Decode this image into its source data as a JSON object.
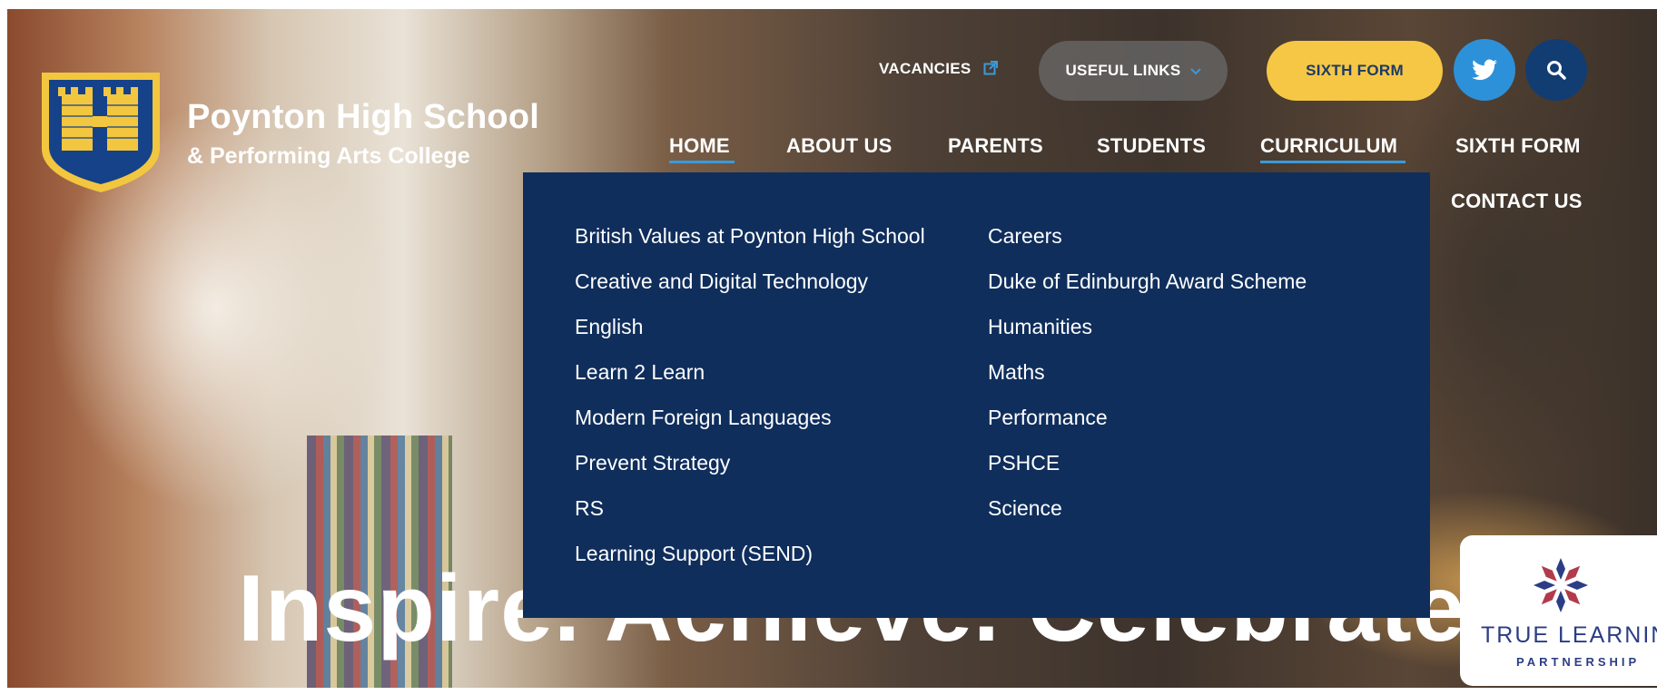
{
  "colors": {
    "navy": "#0f2e5c",
    "accent_yellow": "#f6c744",
    "twitter_blue": "#2d91d9",
    "underline_blue": "#3a9ad9"
  },
  "header": {
    "school_name": "Poynton High School",
    "school_subtitle": "& Performing Arts College"
  },
  "utility_nav": {
    "vacancies": "VACANCIES",
    "useful_links": "USEFUL LINKS",
    "sixth_form": "SIXTH FORM",
    "twitter_icon": "twitter-icon",
    "search_icon": "search-icon"
  },
  "main_nav": {
    "items": [
      "HOME",
      "ABOUT US",
      "PARENTS",
      "STUDENTS",
      "CURRICULUM",
      "SIXTH FORM",
      "CONTACT US"
    ]
  },
  "curriculum_menu": {
    "column1": [
      "British Values at Poynton High School",
      "Creative and Digital Technology",
      "English",
      "Learn 2 Learn",
      "Modern Foreign Languages",
      "Prevent Strategy",
      "RS",
      "Learning Support (SEND)"
    ],
    "column2": [
      "Careers",
      "Duke of Edinburgh Award Scheme",
      "Humanities",
      "Maths",
      "Performance",
      "PSHCE",
      "Science"
    ]
  },
  "hero": {
    "tagline": "Inspire. Achieve. Celebrate."
  },
  "partner": {
    "title": "TRUE LEARNIN",
    "subtitle": "PARTNERSHIP"
  }
}
